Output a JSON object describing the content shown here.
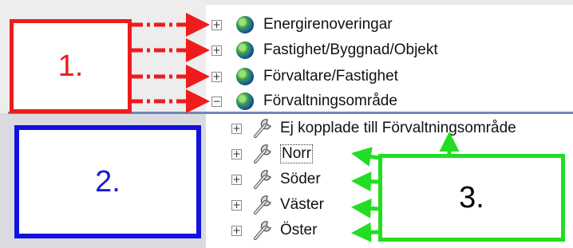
{
  "tree": {
    "top_items": [
      {
        "label": "Energirenoveringar",
        "expander": "+",
        "icon": "globe-icon"
      },
      {
        "label": "Fastighet/Byggnad/Objekt",
        "expander": "+",
        "icon": "globe-icon"
      },
      {
        "label": "Förvaltare/Fastighet",
        "expander": "+",
        "icon": "globe-icon"
      },
      {
        "label": "Förvaltningsområde",
        "expander": "−",
        "icon": "globe-icon"
      }
    ],
    "sub_items": [
      {
        "label": "Ej kopplade till Förvaltningsområde",
        "expander": "+",
        "icon": "wrench-icon"
      },
      {
        "label": "Norr",
        "expander": "+",
        "icon": "wrench-icon",
        "focused": true
      },
      {
        "label": "Söder",
        "expander": "+",
        "icon": "wrench-icon"
      },
      {
        "label": "Väster",
        "expander": "+",
        "icon": "wrench-icon"
      },
      {
        "label": "Öster",
        "expander": "+",
        "icon": "wrench-icon"
      }
    ]
  },
  "callouts": {
    "red": {
      "label": "1.",
      "color": "#ee1c1c"
    },
    "blue": {
      "label": "2.",
      "color": "#1212dd"
    },
    "green": {
      "label": "3.",
      "color": "#22dd22"
    }
  }
}
